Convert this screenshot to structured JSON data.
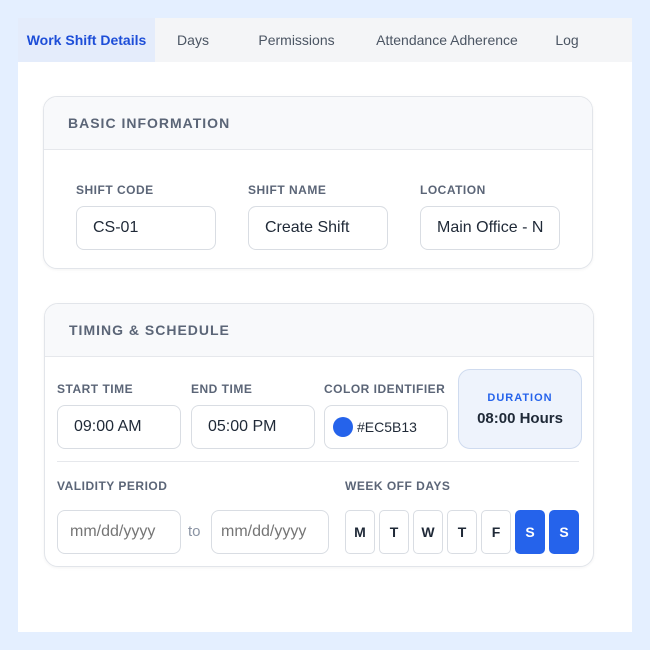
{
  "tabs": [
    {
      "label": "Work Shift Details",
      "active": true
    },
    {
      "label": "Days",
      "active": false
    },
    {
      "label": "Permissions",
      "active": false
    },
    {
      "label": "Attendance Adherence",
      "active": false
    },
    {
      "label": "Log",
      "active": false
    }
  ],
  "basic": {
    "title": "BASIC INFORMATION",
    "shift_code": {
      "label": "SHIFT CODE",
      "value": "CS-01"
    },
    "shift_name": {
      "label": "SHIFT NAME",
      "value": "Create Shift"
    },
    "location": {
      "label": "LOCATION",
      "value": "Main Office - N"
    }
  },
  "timing": {
    "title": "TIMING & SCHEDULE",
    "start_time": {
      "label": "START TIME",
      "value": "09:00 AM"
    },
    "end_time": {
      "label": "END TIME",
      "value": "05:00 PM"
    },
    "color_identifier": {
      "label": "COLOR IDENTIFIER",
      "value": "#EC5B13",
      "swatch": "#2563eb"
    },
    "duration": {
      "label": "DURATION",
      "value": "08:00 Hours"
    },
    "validity": {
      "label": "VALIDITY PERIOD",
      "from_placeholder": "mm/dd/yyyy",
      "to_text": "to",
      "to_placeholder": "mm/dd/yyyy"
    },
    "week_off": {
      "label": "WEEK OFF DAYS",
      "days": [
        {
          "label": "M",
          "selected": false
        },
        {
          "label": "T",
          "selected": false
        },
        {
          "label": "W",
          "selected": false
        },
        {
          "label": "T",
          "selected": false
        },
        {
          "label": "F",
          "selected": false
        },
        {
          "label": "S",
          "selected": true
        },
        {
          "label": "S",
          "selected": true
        }
      ]
    }
  },
  "colors": {
    "accent": "#2563eb",
    "page_bg": "#e4efff"
  }
}
